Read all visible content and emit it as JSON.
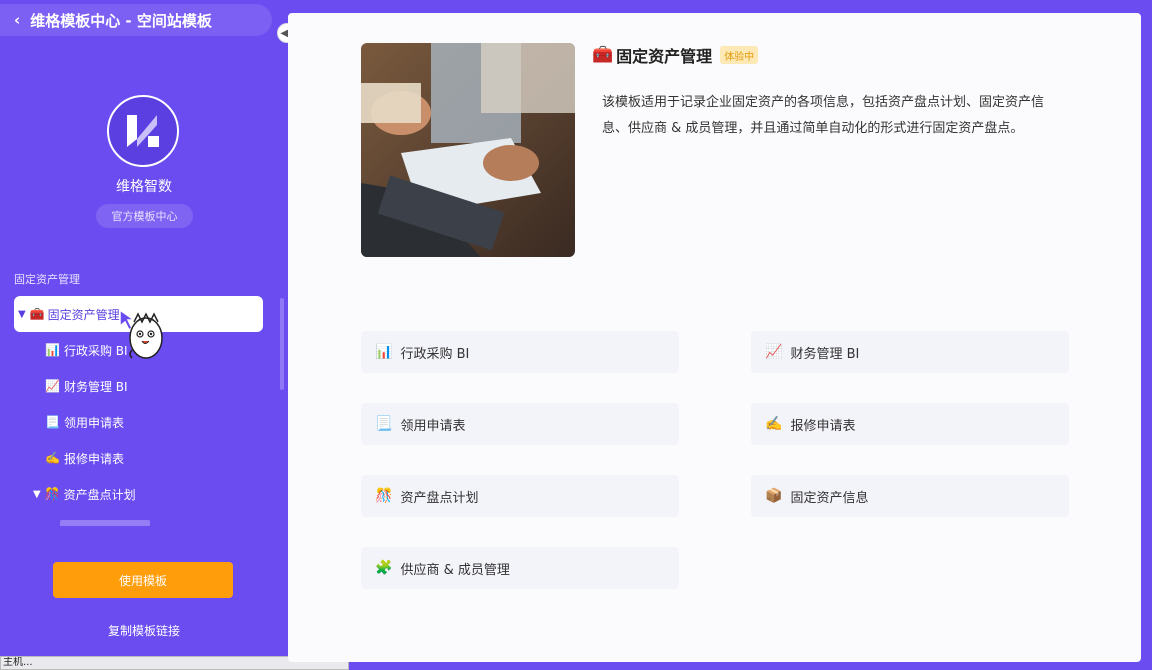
{
  "header": {
    "back_icon": "chevron-left-icon",
    "title": "维格模板中心 - 空间站模板"
  },
  "org": {
    "name": "维格智数",
    "badge": "官方模板中心"
  },
  "sidebar": {
    "section_label": "固定资产管理",
    "tree": [
      {
        "emoji": "🧰",
        "label": "固定资产管理",
        "expanded": true,
        "active": true
      },
      {
        "emoji": "📊",
        "label": "行政采购 BI"
      },
      {
        "emoji": "📈",
        "label": "财务管理 BI"
      },
      {
        "emoji": "📃",
        "label": "领用申请表"
      },
      {
        "emoji": "✍️",
        "label": "报修申请表"
      },
      {
        "emoji": "🎊",
        "label": "资产盘点计划",
        "expanded": true
      }
    ],
    "use_button": "使用模板",
    "copy_link": "复制模板链接"
  },
  "statusbar": {
    "text": "主机..."
  },
  "template": {
    "emoji": "🧰",
    "title": "固定资产管理",
    "badge": "体验中",
    "description": "该模板适用于记录企业固定资产的各项信息，包括资产盘点计划、固定资产信息、供应商 & 成员管理，并且通过简单自动化的形式进行固定资产盘点。"
  },
  "cards": [
    {
      "emoji": "📊",
      "label": "行政采购 BI"
    },
    {
      "emoji": "📈",
      "label": "财务管理 BI"
    },
    {
      "emoji": "📃",
      "label": "领用申请表"
    },
    {
      "emoji": "✍️",
      "label": "报修申请表"
    },
    {
      "emoji": "🎊",
      "label": "资产盘点计划"
    },
    {
      "emoji": "📦",
      "label": "固定资产信息"
    },
    {
      "emoji": "🧩",
      "label": "供应商 & 成员管理"
    }
  ],
  "colors": {
    "sidebar_bg": "#6a4cf0",
    "accent": "#ff9d0a",
    "badge_bg": "#fde9b6"
  }
}
